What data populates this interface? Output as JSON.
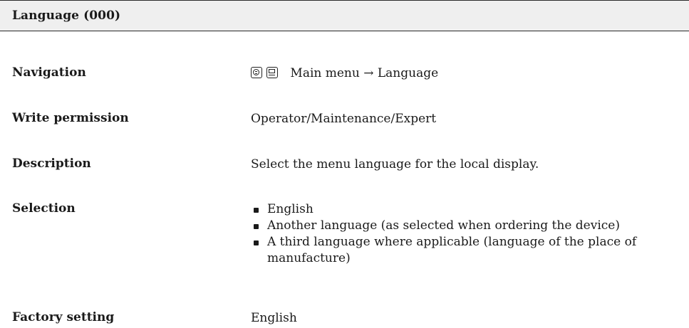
{
  "header": {
    "title": "Language (000)"
  },
  "navigation": {
    "label": "Navigation",
    "icons": [
      "operation-key-icon",
      "display-key-icon"
    ],
    "path": "Main menu → Language"
  },
  "write_permission": {
    "label": "Write permission",
    "value": "Operator/Maintenance/Expert"
  },
  "description": {
    "label": "Description",
    "value": "Select the menu language for the local display."
  },
  "selection": {
    "label": "Selection",
    "items": [
      "English",
      "Another language (as selected when ordering the device)",
      "A third language where applicable (language of the place of manufacture)"
    ]
  },
  "factory_setting": {
    "label": "Factory setting",
    "value": "English"
  }
}
